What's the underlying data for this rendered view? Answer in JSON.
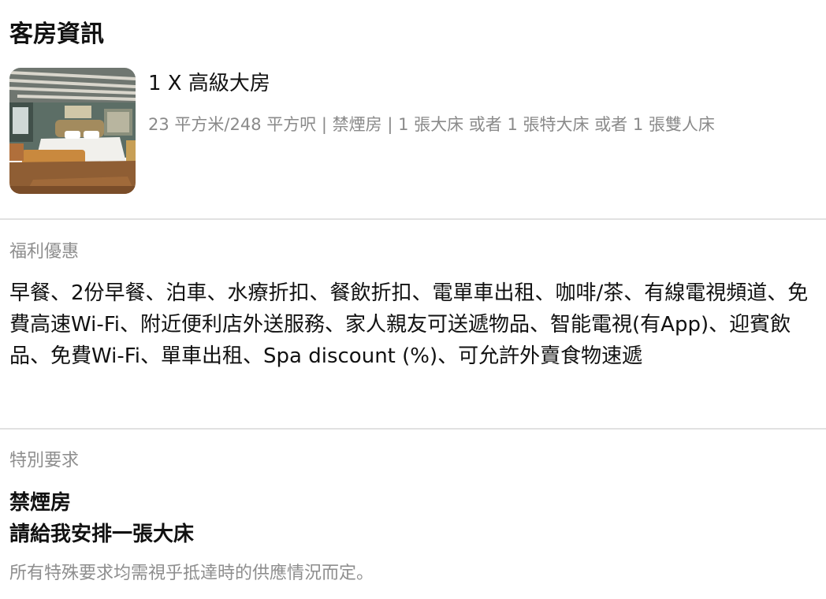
{
  "room_info": {
    "title": "客房資訊",
    "room_name": "1 X 高級大房",
    "room_details": "23 平方米/248 平方呎 | 禁煙房 | 1 張大床 或者 1 張特大床 或者 1 張雙人床"
  },
  "benefits": {
    "label": "福利優惠",
    "text": "早餐、2份早餐、泊車、水療折扣、餐飲折扣、電單車出租、咖啡/茶、有線電視頻道、免費高速Wi-Fi、附近便利店外送服務、家人親友可送遞物品、智能電視(有App)、迎賓飲品、免費Wi-Fi、單車出租、Spa discount (%)、可允許外賣食物速遞"
  },
  "special_requests": {
    "label": "特別要求",
    "items": [
      "禁煙房",
      "請給我安排一張大床"
    ],
    "note": "所有特殊要求均需視乎抵達時的供應情況而定。"
  }
}
